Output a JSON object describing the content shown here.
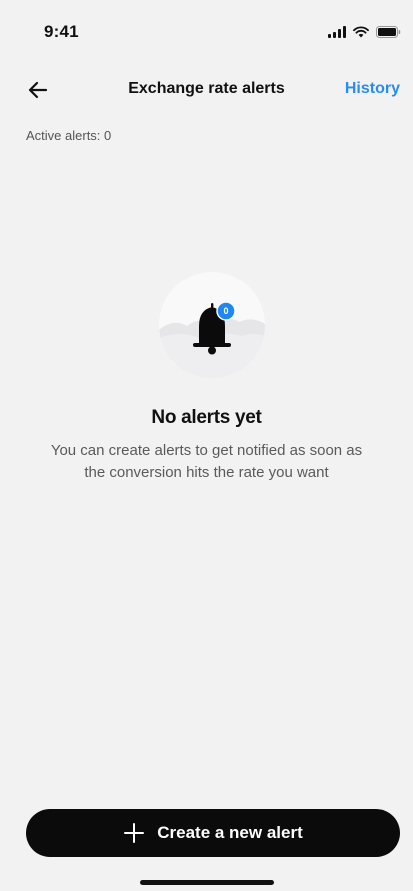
{
  "status_bar": {
    "time": "9:41",
    "icons": [
      "signal-icon",
      "wifi-icon",
      "battery-icon"
    ]
  },
  "header": {
    "back_icon": "arrow-left-icon",
    "title": "Exchange rate alerts",
    "history_label": "History"
  },
  "summary": {
    "active_alerts_text": "Active alerts: 0"
  },
  "empty_state": {
    "illustration": "bell-icon",
    "badge_count": "0",
    "title": "No alerts yet",
    "description": "You can create alerts to get notified as soon as the conversion hits the rate you want"
  },
  "actions": {
    "create_icon": "plus-icon",
    "create_label": "Create a new alert"
  },
  "colors": {
    "accent": "#2b8cf0",
    "background": "#f2f2f3",
    "button": "#0b0b0b",
    "badge": "#1e88f0"
  }
}
